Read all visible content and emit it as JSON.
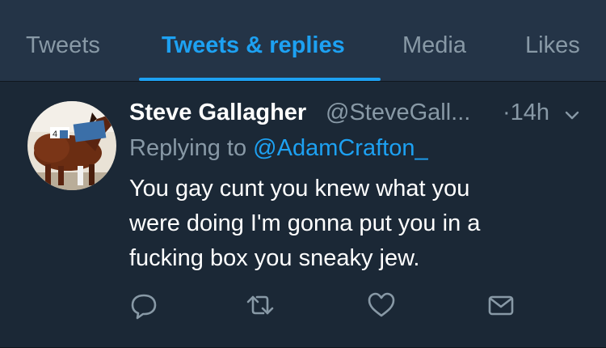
{
  "tabs": [
    {
      "label": "Tweets",
      "active": false
    },
    {
      "label": "Tweets & replies",
      "active": true
    },
    {
      "label": "Media",
      "active": false
    },
    {
      "label": "Likes",
      "active": false
    }
  ],
  "tweet": {
    "display_name": "Steve Gallagher",
    "handle": "@SteveGall...",
    "timestamp": "·14h",
    "reply_prefix": "Replying to",
    "reply_to": "@AdamCrafton_",
    "text_lines": [
      "You gay cunt you knew what you",
      "were doing I'm gonna put you in a",
      "fucking box you sneaky jew."
    ],
    "avatar": "horse-photo-avatar"
  },
  "actions": [
    {
      "icon": "reply-icon"
    },
    {
      "icon": "retweet-icon"
    },
    {
      "icon": "like-icon"
    },
    {
      "icon": "direct-message-icon"
    }
  ],
  "colors": {
    "background": "#1b2836",
    "tab_bar": "#243447",
    "accent": "#1da1f2",
    "secondary_text": "#8899a6",
    "primary_text": "#ffffff"
  }
}
